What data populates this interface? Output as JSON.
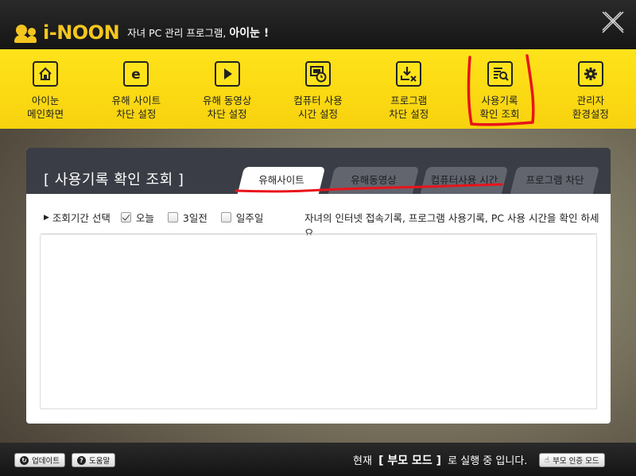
{
  "header": {
    "logo_text": "i-NOON",
    "subtitle_prefix": "자녀 PC 관리 프로그램,",
    "subtitle_brand": "아이눈 !"
  },
  "toolbar": [
    {
      "name": "home",
      "icon": "home-icon",
      "label": "아이눈\n메인화면"
    },
    {
      "name": "block-site",
      "icon": "ie-icon",
      "label": "유해 사이트\n차단 설정"
    },
    {
      "name": "block-video",
      "icon": "play-icon",
      "label": "유해 동영상\n차단 설정"
    },
    {
      "name": "pc-time",
      "icon": "monitor-clock-icon",
      "label": "컴퓨터 사용\n시간 설정"
    },
    {
      "name": "block-program",
      "icon": "download-block-icon",
      "label": "프로그램\n차단 설정"
    },
    {
      "name": "usage-log",
      "icon": "log-search-icon",
      "label": "사용기록\n확인 조회"
    },
    {
      "name": "admin-settings",
      "icon": "gear-icon",
      "label": "관리자\n환경설정"
    }
  ],
  "panel": {
    "title": "[  사용기록 확인 조회  ]",
    "tabs": [
      {
        "label": "유해사이트",
        "active": true
      },
      {
        "label": "유해동영상",
        "active": false
      },
      {
        "label": "컴퓨터사용 시간",
        "active": false
      },
      {
        "label": "프로그램 차단",
        "active": false
      }
    ],
    "period_label": "조회기간 선택",
    "options": [
      {
        "label": "오늘",
        "checked": true
      },
      {
        "label": "3일전",
        "checked": false
      },
      {
        "label": "일주일",
        "checked": false
      }
    ],
    "help_text": "자녀의 인터넷 접속기록, 프로그램 사용기록, PC 사용 시간을 확인 하세요."
  },
  "footer": {
    "update_label": "업데이트",
    "help_label": "도움말",
    "status_prefix": "현재",
    "status_mode": "[ 부모 모드 ]",
    "status_suffix": "로 실행 중 입니다.",
    "auth_label": "부모 인증 모드"
  },
  "colors": {
    "toolbar_yellow": "#ffe31a",
    "brand_yellow": "#f4c61f",
    "header_dark": "#1c1c1c",
    "panel_head": "#3a3d45",
    "annotation_red": "#e8141c"
  }
}
